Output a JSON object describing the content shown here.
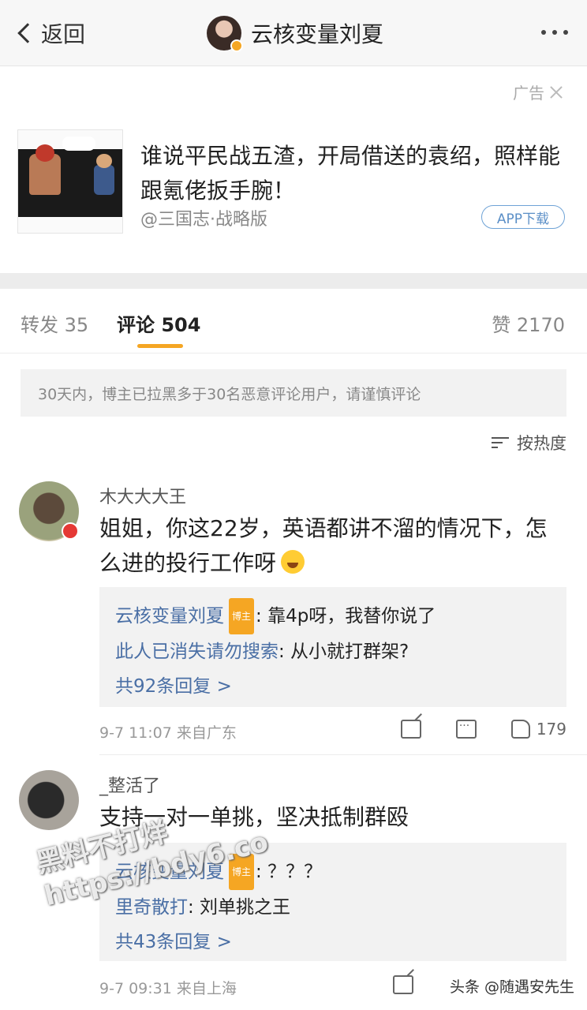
{
  "nav": {
    "back_label": "返回",
    "title": "云核变量刘夏"
  },
  "ad": {
    "tag": "广告",
    "title": "谁说平民战五渣，开局借送的袁绍，照样能跟氪佬扳手腕！",
    "source": "@三国志·战略版",
    "download_label": "APP下载"
  },
  "tabs": {
    "repost": "转发 35",
    "comments": "评论 504",
    "likes": "赞 2170"
  },
  "notice": "30天内，博主已拉黑多于30名恶意评论用户，请谨慎评论",
  "sort_label": "按热度",
  "comments": [
    {
      "name": "木大大大王",
      "text": "姐姐，你这22岁，英语都讲不溜的情况下，怎么进的投行工作呀",
      "replies": [
        {
          "author": "云核变量刘夏",
          "badge": "博主",
          "text": ": 靠4p呀，我替你说了"
        },
        {
          "author": "此人已消失请勿搜索",
          "text": ": 从小就打群架?"
        }
      ],
      "more_replies": "共92条回复 >",
      "time": "9-7 11:07",
      "location": "来自广东",
      "likes": "179"
    },
    {
      "name": "_整活了",
      "text": "支持一对一单挑，坚决抵制群殴",
      "replies": [
        {
          "author": "云核变量刘夏",
          "badge": "博主",
          "text": ": ？？？"
        },
        {
          "author": "里奇散打",
          "text": ": 刘单挑之王"
        }
      ],
      "more_replies": "共43条回复 >",
      "time": "9-7 09:31",
      "location": "来自上海"
    }
  ],
  "watermark": {
    "line1": "黑料不打烊",
    "line2": "https://bdy6.co",
    "bottom": "头条 @随遇安先生"
  }
}
